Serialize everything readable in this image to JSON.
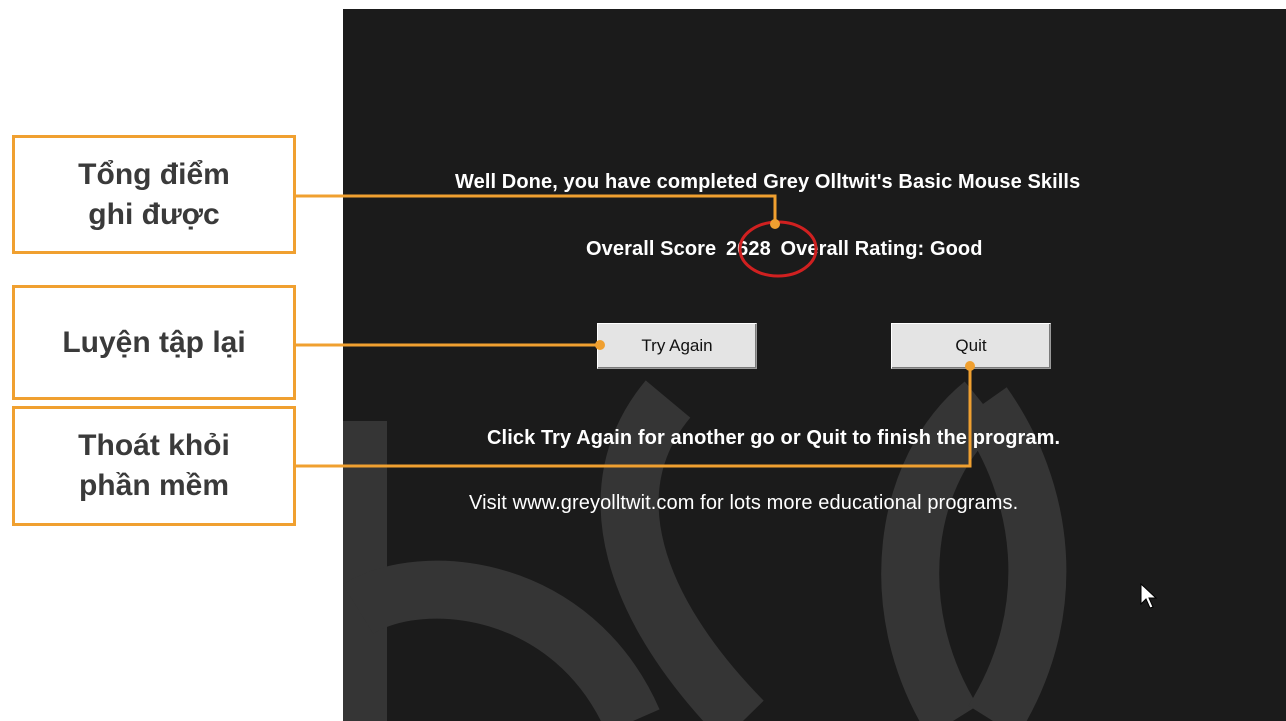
{
  "app": {
    "completion_message": "Well Done, you have completed Grey Olltwit's Basic Mouse Skills",
    "score_label": "Overall Score",
    "score_value": "2628",
    "rating_label": "Overall Rating:",
    "rating_value": "Good",
    "try_again_label": "Try Again",
    "quit_label": "Quit",
    "instruction": "Click Try Again for another go or Quit to finish the program.",
    "visit_text": "Visit www.greyolltwit.com for lots more educational programs."
  },
  "callouts": {
    "total_score": [
      "Tổng điểm",
      "ghi được"
    ],
    "retry": "Luyện tập lại",
    "exit": [
      "Thoát khỏi",
      "phần mềm"
    ]
  },
  "colors": {
    "background": "#1b1b1b",
    "text": "#ffffff",
    "callout_border": "#f0a030",
    "score_highlight": "#d02020"
  }
}
